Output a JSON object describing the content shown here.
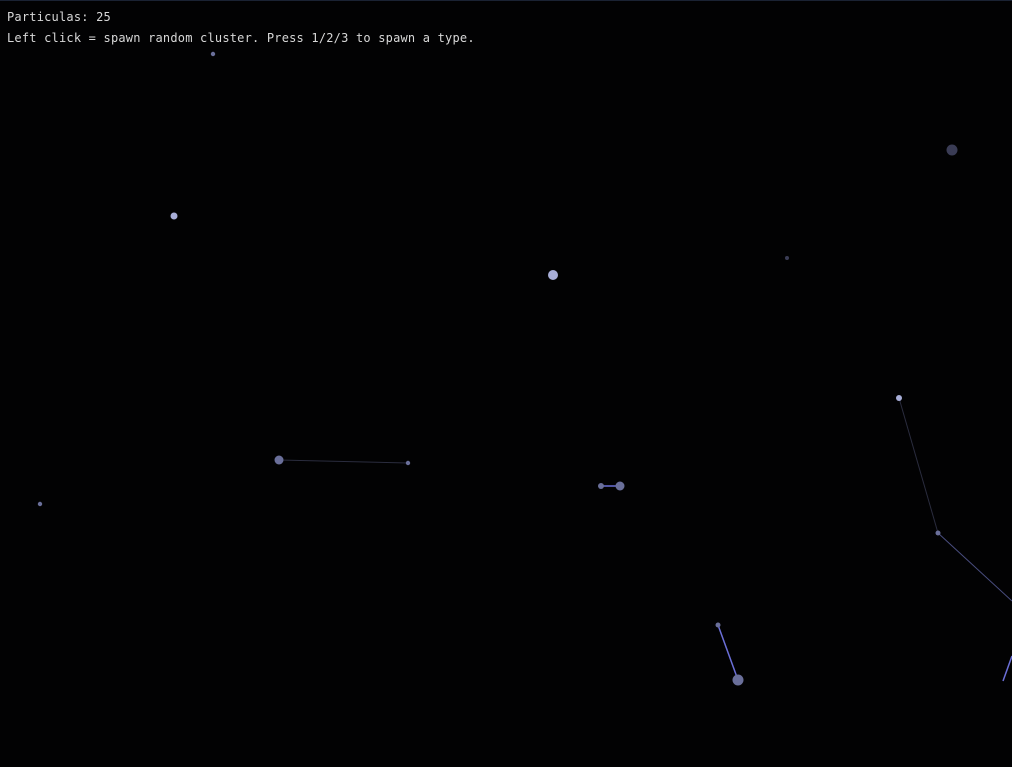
{
  "hud": {
    "count_label": "Particulas:",
    "count_value": "25",
    "help_text": "Left click = spawn random cluster. Press 1/2/3 to spawn a type."
  },
  "colors": {
    "background": "#020203",
    "text": "#d8d8d8",
    "particle_bright": "#a8aed8",
    "particle_mid": "#6a6f9a",
    "particle_dim": "#3a3c55",
    "link_bright": "#6b6fd8",
    "link_mid": "#4a4e80",
    "link_dim": "#2a2c3e"
  }
}
